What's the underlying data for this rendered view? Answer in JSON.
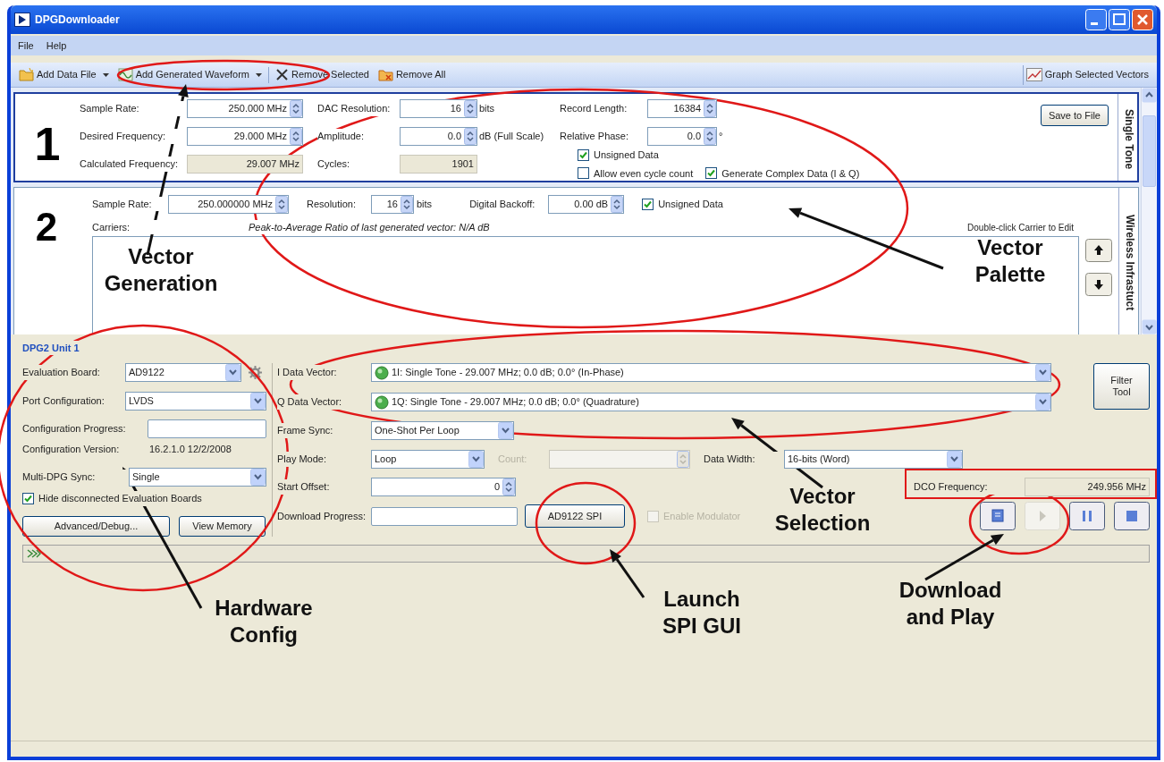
{
  "window": {
    "title": "DPGDownloader"
  },
  "menu": [
    {
      "label": "File"
    },
    {
      "label": "Help"
    }
  ],
  "toolbar": {
    "items": [
      {
        "label": "Add Data File",
        "dropdown": true
      },
      {
        "label": "Add Generated Waveform",
        "dropdown": true
      },
      {
        "label": "Remove Selected",
        "dropdown": false
      },
      {
        "label": "Remove All",
        "dropdown": false
      }
    ],
    "right_item": {
      "label": "Graph Selected Vectors"
    }
  },
  "single_tone": {
    "number": "1",
    "tab_label": "Single Tone",
    "rows": [
      [
        {
          "label": "Sample Rate:",
          "value": "250.000 MHz",
          "kind": "spinner"
        },
        {
          "label": "DAC Resolution:",
          "value": "16",
          "kind": "spinner",
          "unit": "bits"
        },
        {
          "label": "Record Length:",
          "value": "16384",
          "kind": "spinner"
        }
      ],
      [
        {
          "label": "Desired Frequency:",
          "value": "29.000 MHz",
          "kind": "spinner"
        },
        {
          "label": "Amplitude:",
          "value": "0.0",
          "kind": "spinner",
          "unit": "dB (Full Scale)"
        },
        {
          "label": "Relative Phase:",
          "value": "0.0",
          "kind": "spinner",
          "unit": "°"
        }
      ],
      [
        {
          "label": "Calculated Frequency:",
          "value": "29.007 MHz",
          "kind": "readout"
        },
        {
          "label": "Cycles:",
          "value": "1901",
          "kind": "readout"
        }
      ]
    ],
    "checkboxes": [
      {
        "label": "Unsigned Data",
        "checked": true
      },
      {
        "label": "Allow even cycle count",
        "checked": false
      },
      {
        "label": "Generate Complex Data (I & Q)",
        "checked": true
      }
    ],
    "save_button": "Save to File"
  },
  "wireless": {
    "number": "2",
    "tab_label": "Wireless Infrastuct",
    "fields": [
      {
        "label": "Sample Rate:",
        "value": "250.000000 MHz"
      },
      {
        "label": "Resolution:",
        "value": "16",
        "unit": "bits"
      },
      {
        "label": "Digital Backoff:",
        "value": "0.00 dB"
      }
    ],
    "checkbox": {
      "label": "Unsigned Data",
      "checked": true
    },
    "carriers_label": "Carriers:",
    "papr_note": "Peak-to-Average Ratio of last generated vector: N/A dB",
    "edit_hint": "Double-click Carrier to Edit"
  },
  "unit": {
    "title": "DPG2 Unit 1",
    "hardware": [
      {
        "kind": "combo",
        "label": "Evaluation Board:",
        "value": "AD9122"
      },
      {
        "kind": "combo",
        "label": "Port Configuration:",
        "value": "LVDS"
      },
      {
        "kind": "field",
        "label": "Configuration Progress:"
      },
      {
        "kind": "readout",
        "label": "Configuration Version:",
        "value": "16.2.1.0 12/2/2008"
      },
      {
        "kind": "combo",
        "label": "Multi-DPG Sync:",
        "value": "Single"
      },
      {
        "kind": "checkbox",
        "label": "Hide disconnected Evaluation Boards",
        "checked": true
      }
    ],
    "hardware_buttons": [
      "Advanced/Debug...",
      "View Memory"
    ],
    "vectors": [
      {
        "label": "I Data Vector:",
        "value": "1I: Single Tone - 29.007 MHz; 0.0 dB; 0.0° (In-Phase)"
      },
      {
        "label": "Q Data Vector:",
        "value": "1Q: Single Tone - 29.007 MHz; 0.0 dB; 0.0° (Quadrature)"
      }
    ],
    "filter_button": "Filter Tool",
    "frame_sync": {
      "label": "Frame Sync:",
      "value": "One-Shot Per Loop"
    },
    "play_mode": {
      "label": "Play Mode:",
      "value": "Loop"
    },
    "count": {
      "label": "Count:",
      "disabled": true
    },
    "data_width": {
      "label": "Data Width:",
      "value": "16-bits (Word)"
    },
    "start_offset": {
      "label": "Start Offset:",
      "value": "0"
    },
    "dco": {
      "label": "DCO Frequency:",
      "value": "249.956 MHz"
    },
    "download": {
      "label": "Download Progress:"
    },
    "spi_button": "AD9122 SPI",
    "modulator": {
      "label": "Enable Modulator",
      "checked": false,
      "disabled": true
    },
    "transport": [
      {
        "kind": "download",
        "disabled": false
      },
      {
        "kind": "play",
        "disabled": true
      },
      {
        "kind": "pause",
        "disabled": false
      },
      {
        "kind": "stop",
        "disabled": false
      }
    ]
  },
  "annotations": [
    "Vector Generation",
    "Vector Palette",
    "Vector Selection",
    "Hardware Config",
    "Launch SPI GUI",
    "Download and Play"
  ]
}
